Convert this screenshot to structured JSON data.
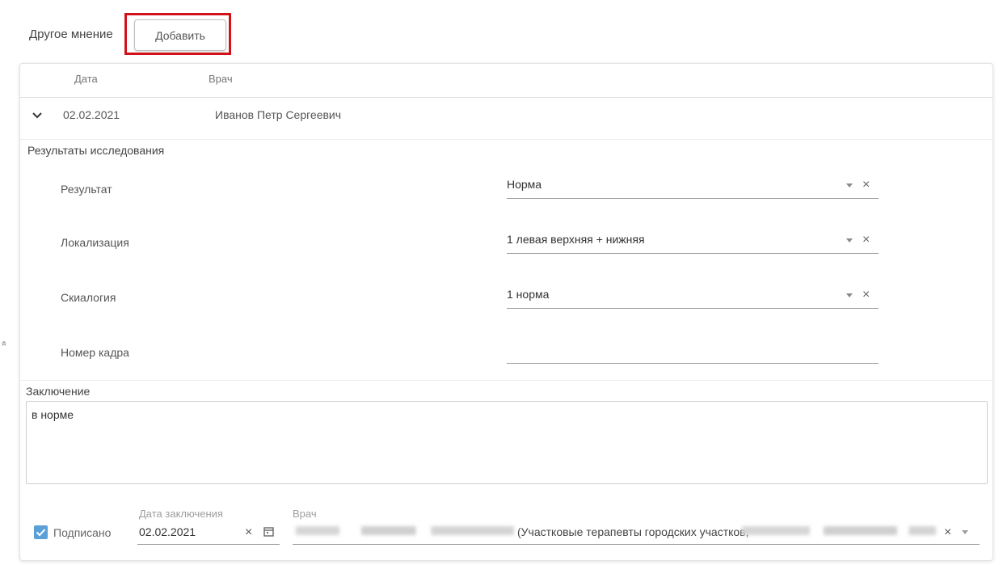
{
  "other_opinion": {
    "title": "Другое мнение",
    "add_button": "Добавить"
  },
  "table": {
    "headers": [
      "Дата",
      "Врач"
    ],
    "row": {
      "date": "02.02.2021",
      "doctor": "Иванов Петр Сергеевич"
    }
  },
  "results": {
    "title": "Результаты исследования",
    "fields": [
      {
        "label": "Результат",
        "value": "Норма"
      },
      {
        "label": "Локализация",
        "value": "1 левая верхняя + нижняя"
      },
      {
        "label": "Скиалогия",
        "value": "1 норма"
      },
      {
        "label": "Номер кадра",
        "value": ""
      }
    ]
  },
  "conclusion": {
    "title": "Заключение",
    "text": "в норме"
  },
  "footer": {
    "signed_label": "Подписано",
    "signed": true,
    "date_label": "Дата заключения",
    "date_value": "02.02.2021",
    "doctor_label": "Врач",
    "doctor_value_visible": "(Участковые терапевты городских участков,"
  },
  "icons": {
    "chevron": "chevron-down-icon",
    "dropdown": "dropdown-arrow-icon",
    "clear": "close-icon",
    "calendar": "calendar-icon",
    "check": "check-icon"
  },
  "colors": {
    "highlight": "#d1121b",
    "checkbox": "#5a9fd8"
  }
}
